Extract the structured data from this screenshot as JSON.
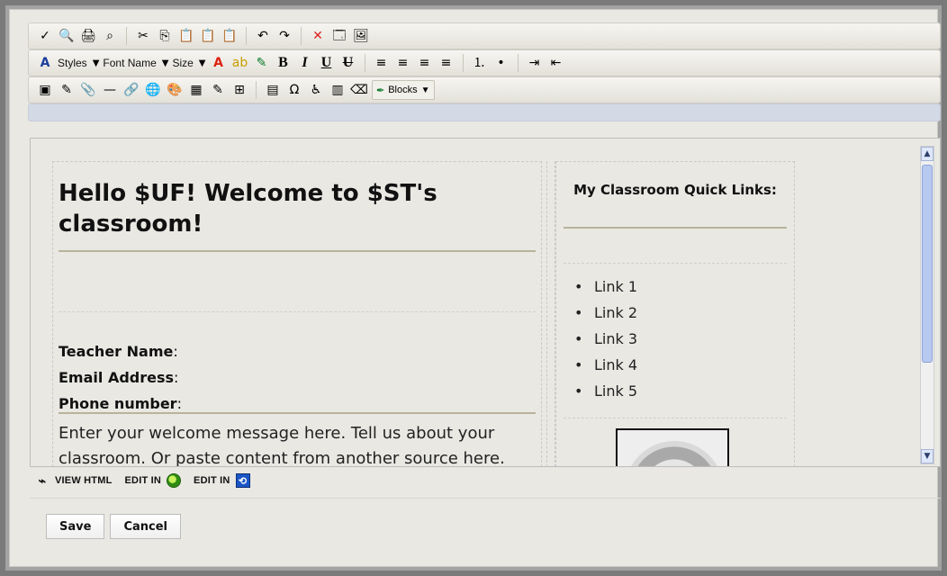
{
  "toolbar_row1": {
    "icons": [
      "spellcheck-icon",
      "find-icon",
      "print-icon",
      "binoculars-icon",
      "cut-icon",
      "copy-icon",
      "paste-icon",
      "paste-text-icon",
      "paste-word-icon",
      "undo-icon",
      "redo-icon",
      "remove-format-icon",
      "source-icon",
      "presentation-icon"
    ]
  },
  "toolbar_row2": {
    "styles_label": "Styles",
    "fontname_label": "Font Name",
    "size_label": "Size",
    "bold_label": "B",
    "italic_label": "I",
    "underline_label": "U",
    "strike_label": "U"
  },
  "toolbar_row3": {
    "blocks_label": "Blocks"
  },
  "document": {
    "title": "Hello $UF! Welcome to $ST's classroom!",
    "info": {
      "teacher_label": "Teacher Name",
      "email_label": "Email Address",
      "phone_label": "Phone number",
      "colon": ":"
    },
    "welcome": "Enter your welcome message here. Tell us about your classroom. Or paste content from another source here.",
    "quick_links_title": "My Classroom Quick Links:",
    "links": [
      "Link 1",
      "Link 2",
      "Link 3",
      "Link 4",
      "Link 5"
    ]
  },
  "status_bar": {
    "view_html_label": "VIEW HTML",
    "edit_in_label_1": "EDIT IN",
    "edit_in_label_2": "EDIT IN"
  },
  "actions": {
    "save_label": "Save",
    "cancel_label": "Cancel"
  }
}
